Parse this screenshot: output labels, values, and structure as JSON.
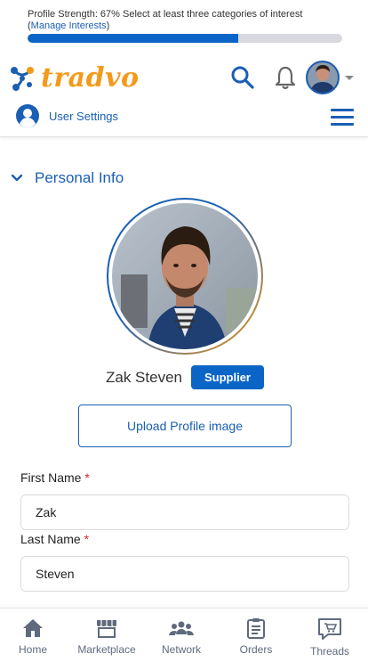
{
  "profile_strength": {
    "text": "Profile Strength: 67% Select at least three categories of interest",
    "open_paren": "(",
    "link": "Manage Interests",
    "close_paren": ")",
    "percent": 67
  },
  "header": {
    "logo_text": "tradvo",
    "icons": [
      "search-icon",
      "bell-icon",
      "avatar",
      "caret-down-icon"
    ]
  },
  "settings": {
    "label": "User Settings"
  },
  "section": {
    "title": "Personal Info"
  },
  "profile": {
    "name": "Zak Steven",
    "badge": "Supplier",
    "upload_label": "Upload Profile image"
  },
  "form": {
    "first_name_label": "First Name",
    "first_name_value": "Zak",
    "last_name_label": "Last Name",
    "last_name_value": "Steven",
    "required_mark": "*"
  },
  "bottom_nav": {
    "items": [
      {
        "label": "Home",
        "icon": "home-icon"
      },
      {
        "label": "Marketplace",
        "icon": "store-icon"
      },
      {
        "label": "Network",
        "icon": "people-icon"
      },
      {
        "label": "Orders",
        "icon": "clipboard-icon"
      },
      {
        "label": "Threads",
        "icon": "chat-icon"
      }
    ]
  },
  "colors": {
    "brand_blue": "#1a5fb4",
    "brand_orange": "#f39a1a",
    "progress_fill": "#0b65c7"
  }
}
